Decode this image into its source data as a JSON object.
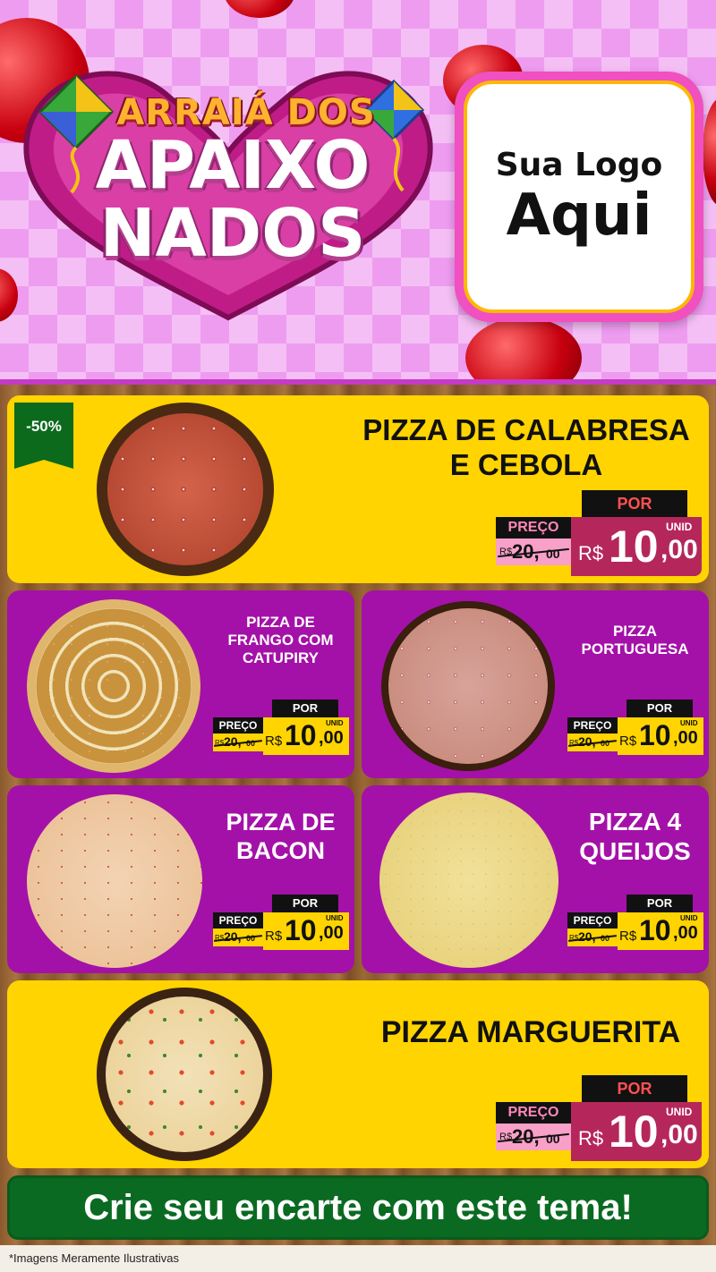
{
  "header": {
    "title_top": "ARRAIÁ DOS",
    "title_line1": "APAIXO",
    "title_line2": "NADOS",
    "logo_line1": "Sua Logo",
    "logo_line2": "Aqui"
  },
  "colors": {
    "header_pink": "#ee9cf0",
    "card_yellow": "#ffd400",
    "card_purple": "#a411a8",
    "price_magenta": "#b5275b",
    "cta_green": "#0b6a22"
  },
  "products": [
    {
      "name_lines": [
        "PIZZA DE CALABRESA",
        "E CEBOLA"
      ],
      "badge": "-50%",
      "preco_label": "PREÇO",
      "por_label": "POR",
      "old_currency": "R$",
      "old_price": "20,",
      "old_cents": "00",
      "currency": "R$",
      "price_int": "10",
      "price_cents": ",00",
      "unit": "UNID"
    },
    {
      "name_lines": [
        "PIZZA DE",
        "FRANGO COM",
        "CATUPIRY"
      ],
      "preco_label": "PREÇO",
      "por_label": "POR",
      "old_currency": "R$",
      "old_price": "20,",
      "old_cents": "00",
      "currency": "R$",
      "price_int": "10",
      "price_cents": ",00",
      "unit": "UNID"
    },
    {
      "name_lines": [
        "PIZZA",
        "PORTUGUESA"
      ],
      "preco_label": "PREÇO",
      "por_label": "POR",
      "old_currency": "R$",
      "old_price": "20,",
      "old_cents": "00",
      "currency": "R$",
      "price_int": "10",
      "price_cents": ",00",
      "unit": "UNID"
    },
    {
      "name_lines": [
        "PIZZA DE",
        "BACON"
      ],
      "preco_label": "PREÇO",
      "por_label": "POR",
      "old_currency": "R$",
      "old_price": "20,",
      "old_cents": "00",
      "currency": "R$",
      "price_int": "10",
      "price_cents": ",00",
      "unit": "UNID"
    },
    {
      "name_lines": [
        "PIZZA 4",
        "QUEIJOS"
      ],
      "preco_label": "PREÇO",
      "por_label": "POR",
      "old_currency": "R$",
      "old_price": "20,",
      "old_cents": "00",
      "currency": "R$",
      "price_int": "10",
      "price_cents": ",00",
      "unit": "UNID"
    },
    {
      "name_lines": [
        "PIZZA MARGUERITA"
      ],
      "preco_label": "PREÇO",
      "por_label": "POR",
      "old_currency": "R$",
      "old_price": "20,",
      "old_cents": "00",
      "currency": "R$",
      "price_int": "10",
      "price_cents": ",00",
      "unit": "UNID"
    }
  ],
  "cta": "Crie seu encarte com este tema!",
  "disclaimer": "*Imagens Meramente Ilustrativas"
}
